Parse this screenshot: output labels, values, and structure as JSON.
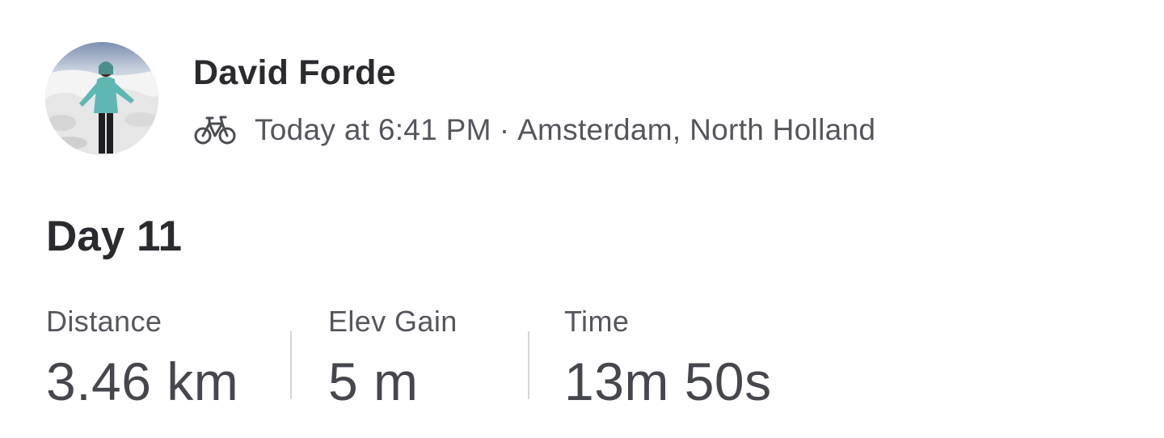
{
  "athlete": {
    "name": "David Forde",
    "avatar_icon": "profile-photo"
  },
  "meta": {
    "activity_icon": "bike-icon",
    "time": "Today at 6:41 PM",
    "separator": "·",
    "location": "Amsterdam, North Holland"
  },
  "activity": {
    "title": "Day 11"
  },
  "stats": {
    "distance": {
      "label": "Distance",
      "value": "3.46 km"
    },
    "elev_gain": {
      "label": "Elev Gain",
      "value": "5 m"
    },
    "time": {
      "label": "Time",
      "value": "13m 50s"
    }
  },
  "colors": {
    "text_primary": "#2b2b2f",
    "text_secondary": "#55565c",
    "divider": "#d6d6da"
  }
}
